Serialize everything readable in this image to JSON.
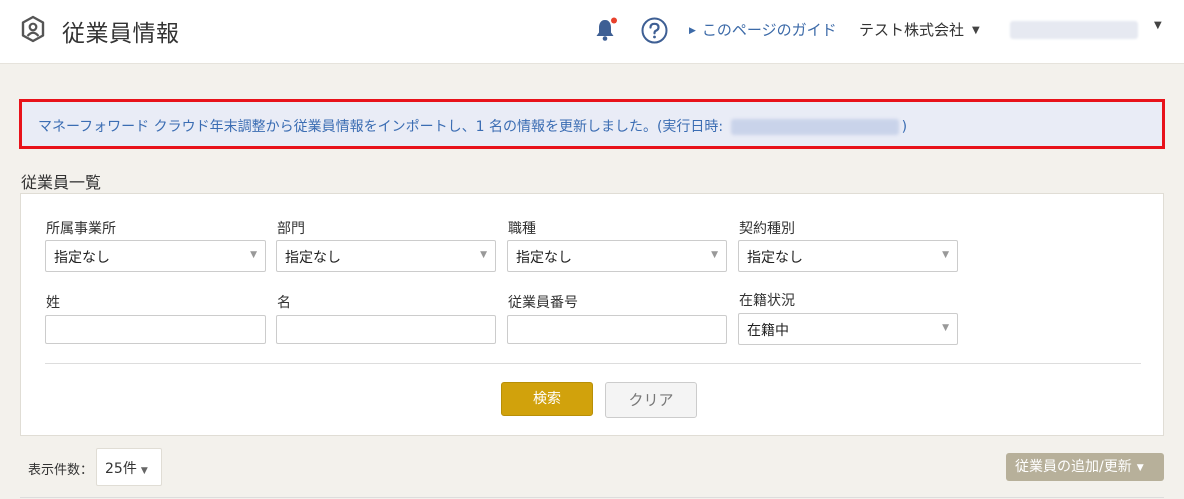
{
  "header": {
    "title": "従業員情報",
    "guide_label": "このページのガイド",
    "company": "テスト株式会社"
  },
  "notice": {
    "text_before": "マネーフォワード クラウド年末調整から従業員情報をインポートし、1 名の情報を更新しました。(実行日時: ",
    "text_after": ")"
  },
  "section_title": "従業員一覧",
  "filters": {
    "office": {
      "label": "所属事業所",
      "value": "指定なし"
    },
    "department": {
      "label": "部門",
      "value": "指定なし"
    },
    "job_type": {
      "label": "職種",
      "value": "指定なし"
    },
    "contract_type": {
      "label": "契約種別",
      "value": "指定なし"
    },
    "last_name": {
      "label": "姓",
      "value": ""
    },
    "first_name": {
      "label": "名",
      "value": ""
    },
    "employee_number": {
      "label": "従業員番号",
      "value": ""
    },
    "status": {
      "label": "在籍状況",
      "value": "在籍中"
    }
  },
  "buttons": {
    "search": "検索",
    "clear": "クリア",
    "add_update": "従業員の追加/更新"
  },
  "pagination": {
    "per_page_label": "表示件数：",
    "per_page_value": "25件"
  },
  "colors": {
    "accent": "#d1a20c",
    "link": "#3c6aa8",
    "highlight_border": "#e8121a",
    "notification_dot": "#e8412c"
  }
}
